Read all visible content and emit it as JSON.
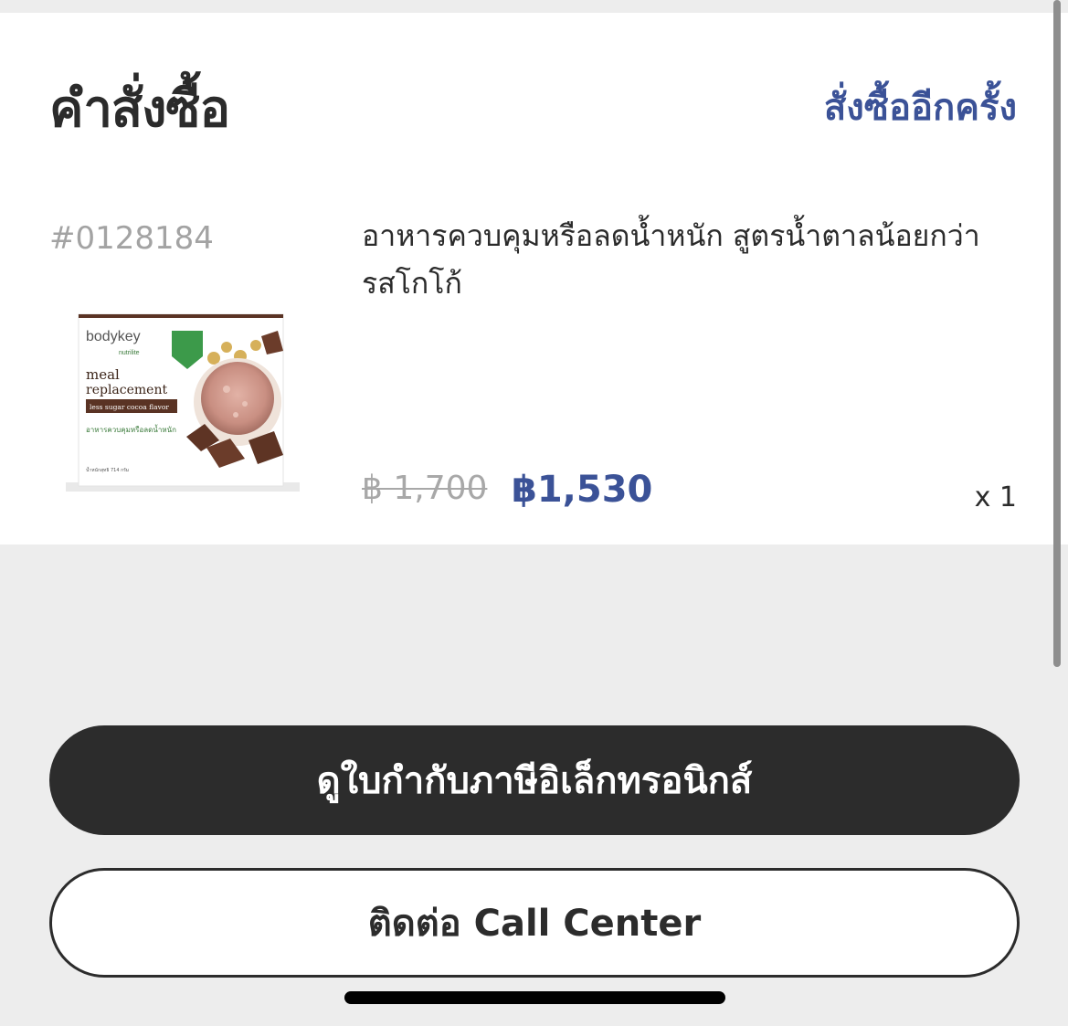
{
  "order": {
    "title": "คำสั่งซื้อ",
    "reorder_label": "สั่งซื้ออีกครั้ง",
    "order_number": "#0128184",
    "product": {
      "name": "อาหารควบคุมหรือลดน้ำหนัก สูตรน้ำตาลน้อยกว่า รสโกโก้",
      "price_original": "฿ 1,700",
      "price_sale": "฿1,530",
      "quantity": "x 1",
      "image": {
        "brand_text": "bodykey",
        "sub_brand_text": "nutrilite",
        "product_line_1": "meal",
        "product_line_2": "replacement",
        "flavor_text": "less sugar cocoa flavor",
        "thai_label": "อาหารควบคุมหรือลดน้ำหนัก",
        "weight_text": "น้ำหนักสุทธิ 714 กรัม"
      }
    }
  },
  "actions": {
    "e_tax_invoice_label": "ดูใบกำกับภาษีอิเล็กทรอนิกส์",
    "call_center_label": "ติดต่อ Call Center"
  },
  "colors": {
    "accent": "#3b5297",
    "dark_button": "#2c2c2c",
    "background": "#ededed"
  }
}
